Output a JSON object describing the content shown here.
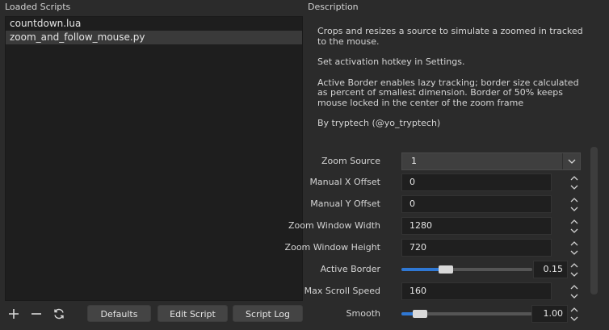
{
  "left": {
    "title": "Loaded Scripts",
    "scripts": [
      "countdown.lua",
      "zoom_and_follow_mouse.py"
    ]
  },
  "toolbar": {
    "add_icon": "plus-icon",
    "remove_icon": "minus-icon",
    "refresh_icon": "refresh-icon",
    "defaults_label": "Defaults",
    "edit_script_label": "Edit Script",
    "script_log_label": "Script Log"
  },
  "right": {
    "title": "Description",
    "description": [
      "Crops and resizes a source to simulate a zoomed in tracked to the mouse.",
      "Set activation hotkey in Settings.",
      "Active Border enables lazy tracking; border size calculated as percent of smallest dimension. Border of 50% keeps mouse locked in the center of the zoom frame",
      "By tryptech (@yo_tryptech)"
    ]
  },
  "properties": {
    "zoom_source": {
      "label": "Zoom Source",
      "value": "1"
    },
    "manual_x_offset": {
      "label": "Manual X Offset",
      "value": "0"
    },
    "manual_y_offset": {
      "label": "Manual Y Offset",
      "value": "0"
    },
    "zoom_window_width": {
      "label": "Zoom Window Width",
      "value": "1280"
    },
    "zoom_window_height": {
      "label": "Zoom Window Height",
      "value": "720"
    },
    "active_border": {
      "label": "Active Border",
      "value": "0.15",
      "fraction": 0.32
    },
    "max_scroll_speed": {
      "label": "Max Scroll Speed",
      "value": "160"
    },
    "smooth": {
      "label": "Smooth",
      "value": "1.00",
      "fraction": 0.1
    }
  },
  "colors": {
    "accent": "#2f78d4",
    "background": "#2b2b2b"
  }
}
